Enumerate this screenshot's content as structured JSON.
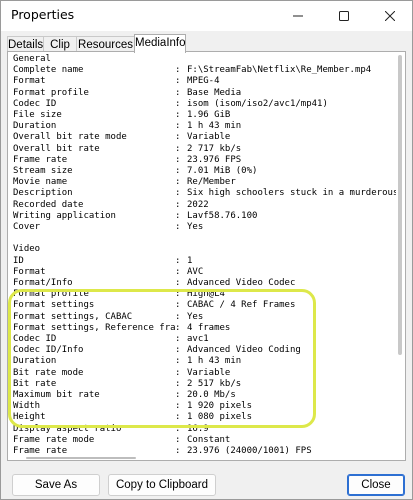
{
  "window": {
    "title": "Properties",
    "minimize_label": "–",
    "maximize_label": "☐",
    "close_label": "✕"
  },
  "tabs": [
    {
      "label": "Details"
    },
    {
      "label": "Clip"
    },
    {
      "label": "Resources"
    },
    {
      "label": "MediaInfo"
    }
  ],
  "active_tab": "MediaInfo",
  "mediainfo": {
    "lines": [
      {
        "key": "General",
        "sep": "",
        "value": ""
      },
      {
        "key": "Complete name",
        "sep": ":",
        "value": "F:\\StreamFab\\Netflix\\Re_Member.mp4"
      },
      {
        "key": "Format",
        "sep": ":",
        "value": "MPEG-4"
      },
      {
        "key": "Format profile",
        "sep": ":",
        "value": "Base Media"
      },
      {
        "key": "Codec ID",
        "sep": ":",
        "value": "isom (isom/iso2/avc1/mp41)"
      },
      {
        "key": "File size",
        "sep": ":",
        "value": "1.96 GiB"
      },
      {
        "key": "Duration",
        "sep": ":",
        "value": "1 h 43 min"
      },
      {
        "key": "Overall bit rate mode",
        "sep": ":",
        "value": "Variable"
      },
      {
        "key": "Overall bit rate",
        "sep": ":",
        "value": "2 717 kb/s"
      },
      {
        "key": "Frame rate",
        "sep": ":",
        "value": "23.976 FPS"
      },
      {
        "key": "Stream size",
        "sep": ":",
        "value": "7.01 MiB (0%)"
      },
      {
        "key": "Movie name",
        "sep": ":",
        "value": "Re/Member"
      },
      {
        "key": "Description",
        "sep": ":",
        "value": "Six high schoolers stuck in a murderous t"
      },
      {
        "key": "Recorded date",
        "sep": ":",
        "value": "2022"
      },
      {
        "key": "Writing application",
        "sep": ":",
        "value": "Lavf58.76.100"
      },
      {
        "key": "Cover",
        "sep": ":",
        "value": "Yes"
      },
      {
        "key": "",
        "sep": "",
        "value": ""
      },
      {
        "key": "Video",
        "sep": "",
        "value": ""
      },
      {
        "key": "ID",
        "sep": ":",
        "value": "1"
      },
      {
        "key": "Format",
        "sep": ":",
        "value": "AVC"
      },
      {
        "key": "Format/Info",
        "sep": ":",
        "value": "Advanced Video Codec"
      },
      {
        "key": "Format profile",
        "sep": ":",
        "value": "High@L4"
      },
      {
        "key": "Format settings",
        "sep": ":",
        "value": "CABAC / 4 Ref Frames"
      },
      {
        "key": "Format settings, CABAC",
        "sep": ":",
        "value": "Yes"
      },
      {
        "key": "Format settings, Reference fra",
        "sep": ":",
        "value": "4 frames"
      },
      {
        "key": "Codec ID",
        "sep": ":",
        "value": "avc1"
      },
      {
        "key": "Codec ID/Info",
        "sep": ":",
        "value": "Advanced Video Coding"
      },
      {
        "key": "Duration",
        "sep": ":",
        "value": "1 h 43 min"
      },
      {
        "key": "Bit rate mode",
        "sep": ":",
        "value": "Variable"
      },
      {
        "key": "Bit rate",
        "sep": ":",
        "value": "2 517 kb/s"
      },
      {
        "key": "Maximum bit rate",
        "sep": ":",
        "value": "20.0 Mb/s"
      },
      {
        "key": "Width",
        "sep": ":",
        "value": "1 920 pixels"
      },
      {
        "key": "Height",
        "sep": ":",
        "value": "1 080 pixels"
      },
      {
        "key": "Display aspect ratio",
        "sep": ":",
        "value": "16:9"
      },
      {
        "key": "Frame rate mode",
        "sep": ":",
        "value": "Constant"
      },
      {
        "key": "Frame rate",
        "sep": ":",
        "value": "23.976 (24000/1001) FPS"
      }
    ]
  },
  "highlight_color": "#dde84a",
  "buttons": {
    "save_as": "Save As",
    "copy": "Copy to Clipboard",
    "close": "Close"
  }
}
